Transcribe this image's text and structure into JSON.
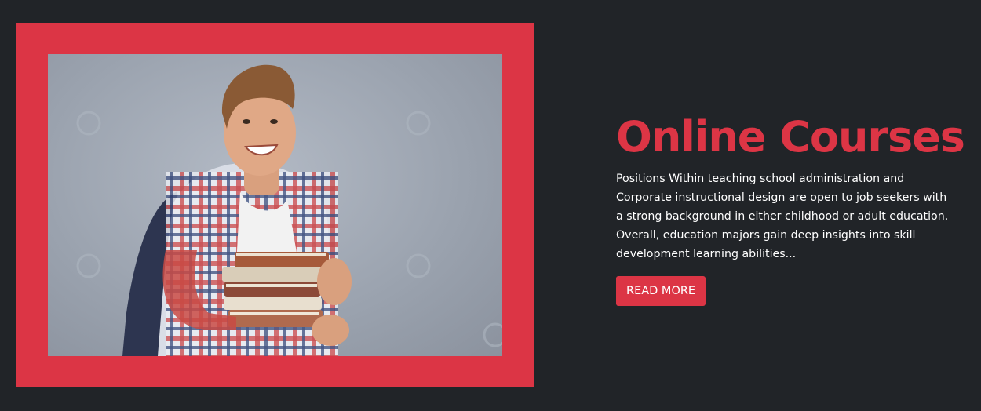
{
  "hero": {
    "title": "Online Courses",
    "description": "Positions Within teaching school administration and Corporate instructional design are open to job seekers with a strong background in either childhood or adult education. Overall, education majors gain deep insights into skill development learning abilities...",
    "button_label": "READ MORE",
    "image": "student-holding-books-photo"
  },
  "colors": {
    "background": "#212428",
    "accent": "#dc3545",
    "text": "#ffffff"
  }
}
